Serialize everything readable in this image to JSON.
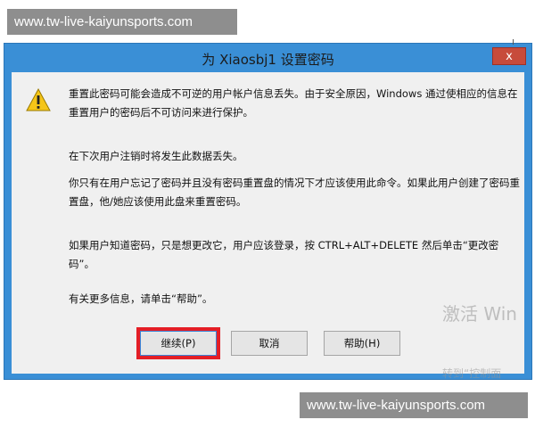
{
  "watermarks": {
    "top": "www.tw-live-kaiyunsports.com",
    "bottom": "www.tw-live-kaiyunsports.com"
  },
  "dialog": {
    "title": "为 Xiaosbj1 设置密码",
    "close_label": "x",
    "icon": "warning-triangle-icon",
    "paragraphs": {
      "p1": "重置此密码可能会造成不可逆的用户帐户信息丢失。由于安全原因，Windows 通过使相应的信息在重置用户的密码后不可访问来进行保护。",
      "p2": "在下次用户注销时将发生此数据丢失。",
      "p3": "你只有在用户忘记了密码并且没有密码重置盘的情况下才应该使用此命令。如果此用户创建了密码重置盘，他/她应该使用此盘来重置密码。",
      "p4": "如果用户知道密码，只是想更改它，用户应该登录，按 CTRL+ALT+DELETE 然后单击“更改密码”。",
      "p5": "有关更多信息，请单击“帮助”。"
    },
    "buttons": {
      "continue": "继续(P)",
      "cancel": "取消",
      "help": "帮助(H)"
    }
  },
  "activation": {
    "line1": "激活 Win",
    "line2": "转到“控制面"
  },
  "colors": {
    "titlebar": "#3a8fd6",
    "highlight": "#e41e26",
    "close": "#c74b3b"
  }
}
